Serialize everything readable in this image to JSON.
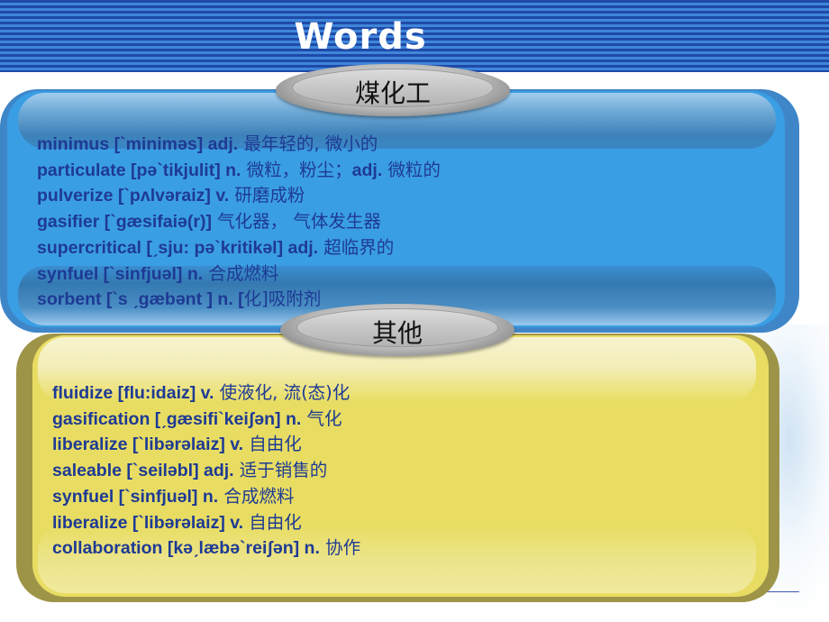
{
  "header": {
    "title": "Words"
  },
  "sections": [
    {
      "badge": "煤化工",
      "color": "#3a9ee4",
      "entries": [
        {
          "en": "minimus [`miniməs] adj.",
          "cn": " 最年轻的, 微小的"
        },
        {
          "en": "particulate [pə`tikjulit]  n.",
          "cn": " 微粒，粉尘；",
          "en2": "adj.",
          "cn2": " 微粒的"
        },
        {
          "en": "pulverize [`pʌlvəraiz]  v.",
          "cn": " 研磨成粉"
        },
        {
          "en": "gasifier [`gæsifaiə(r)]",
          "cn": "  气化器， 气体发生器"
        },
        {
          "en": "supercritical [ˏsju: pə`kritikəl]  adj.",
          "cn": " 超临界的"
        },
        {
          "en": "synfuel [`sinfjuəl]  n.",
          "cn": "  合成燃料"
        },
        {
          "en": "sorbent [`s ˏgæbənt ] n. [",
          "cn": "化]吸附剂"
        }
      ]
    },
    {
      "badge": "其他",
      "color": "#e8dd62",
      "entries": [
        {
          "en": "fluidize [flu:idaiz]  v.",
          "cn": " 使液化, 流(态)化"
        },
        {
          "en": "gasification [ˏgæsifi`keiʃən] n.",
          "cn": " 气化"
        },
        {
          "en": "liberalize [`libərəlaiz]  v.",
          "cn": " 自由化"
        },
        {
          "en": "saleable [`seiləbl]  adj.",
          "cn": "  适于销售的"
        },
        {
          "en": "synfuel [`sinfjuəl]  n.",
          "cn": "  合成燃料"
        },
        {
          "en": "liberalize [`libərəlaiz]  v.",
          "cn": " 自由化"
        },
        {
          "en": "collaboration [kəˏlæbə`reiʃən]  n.",
          "cn": " 协作"
        }
      ]
    }
  ]
}
